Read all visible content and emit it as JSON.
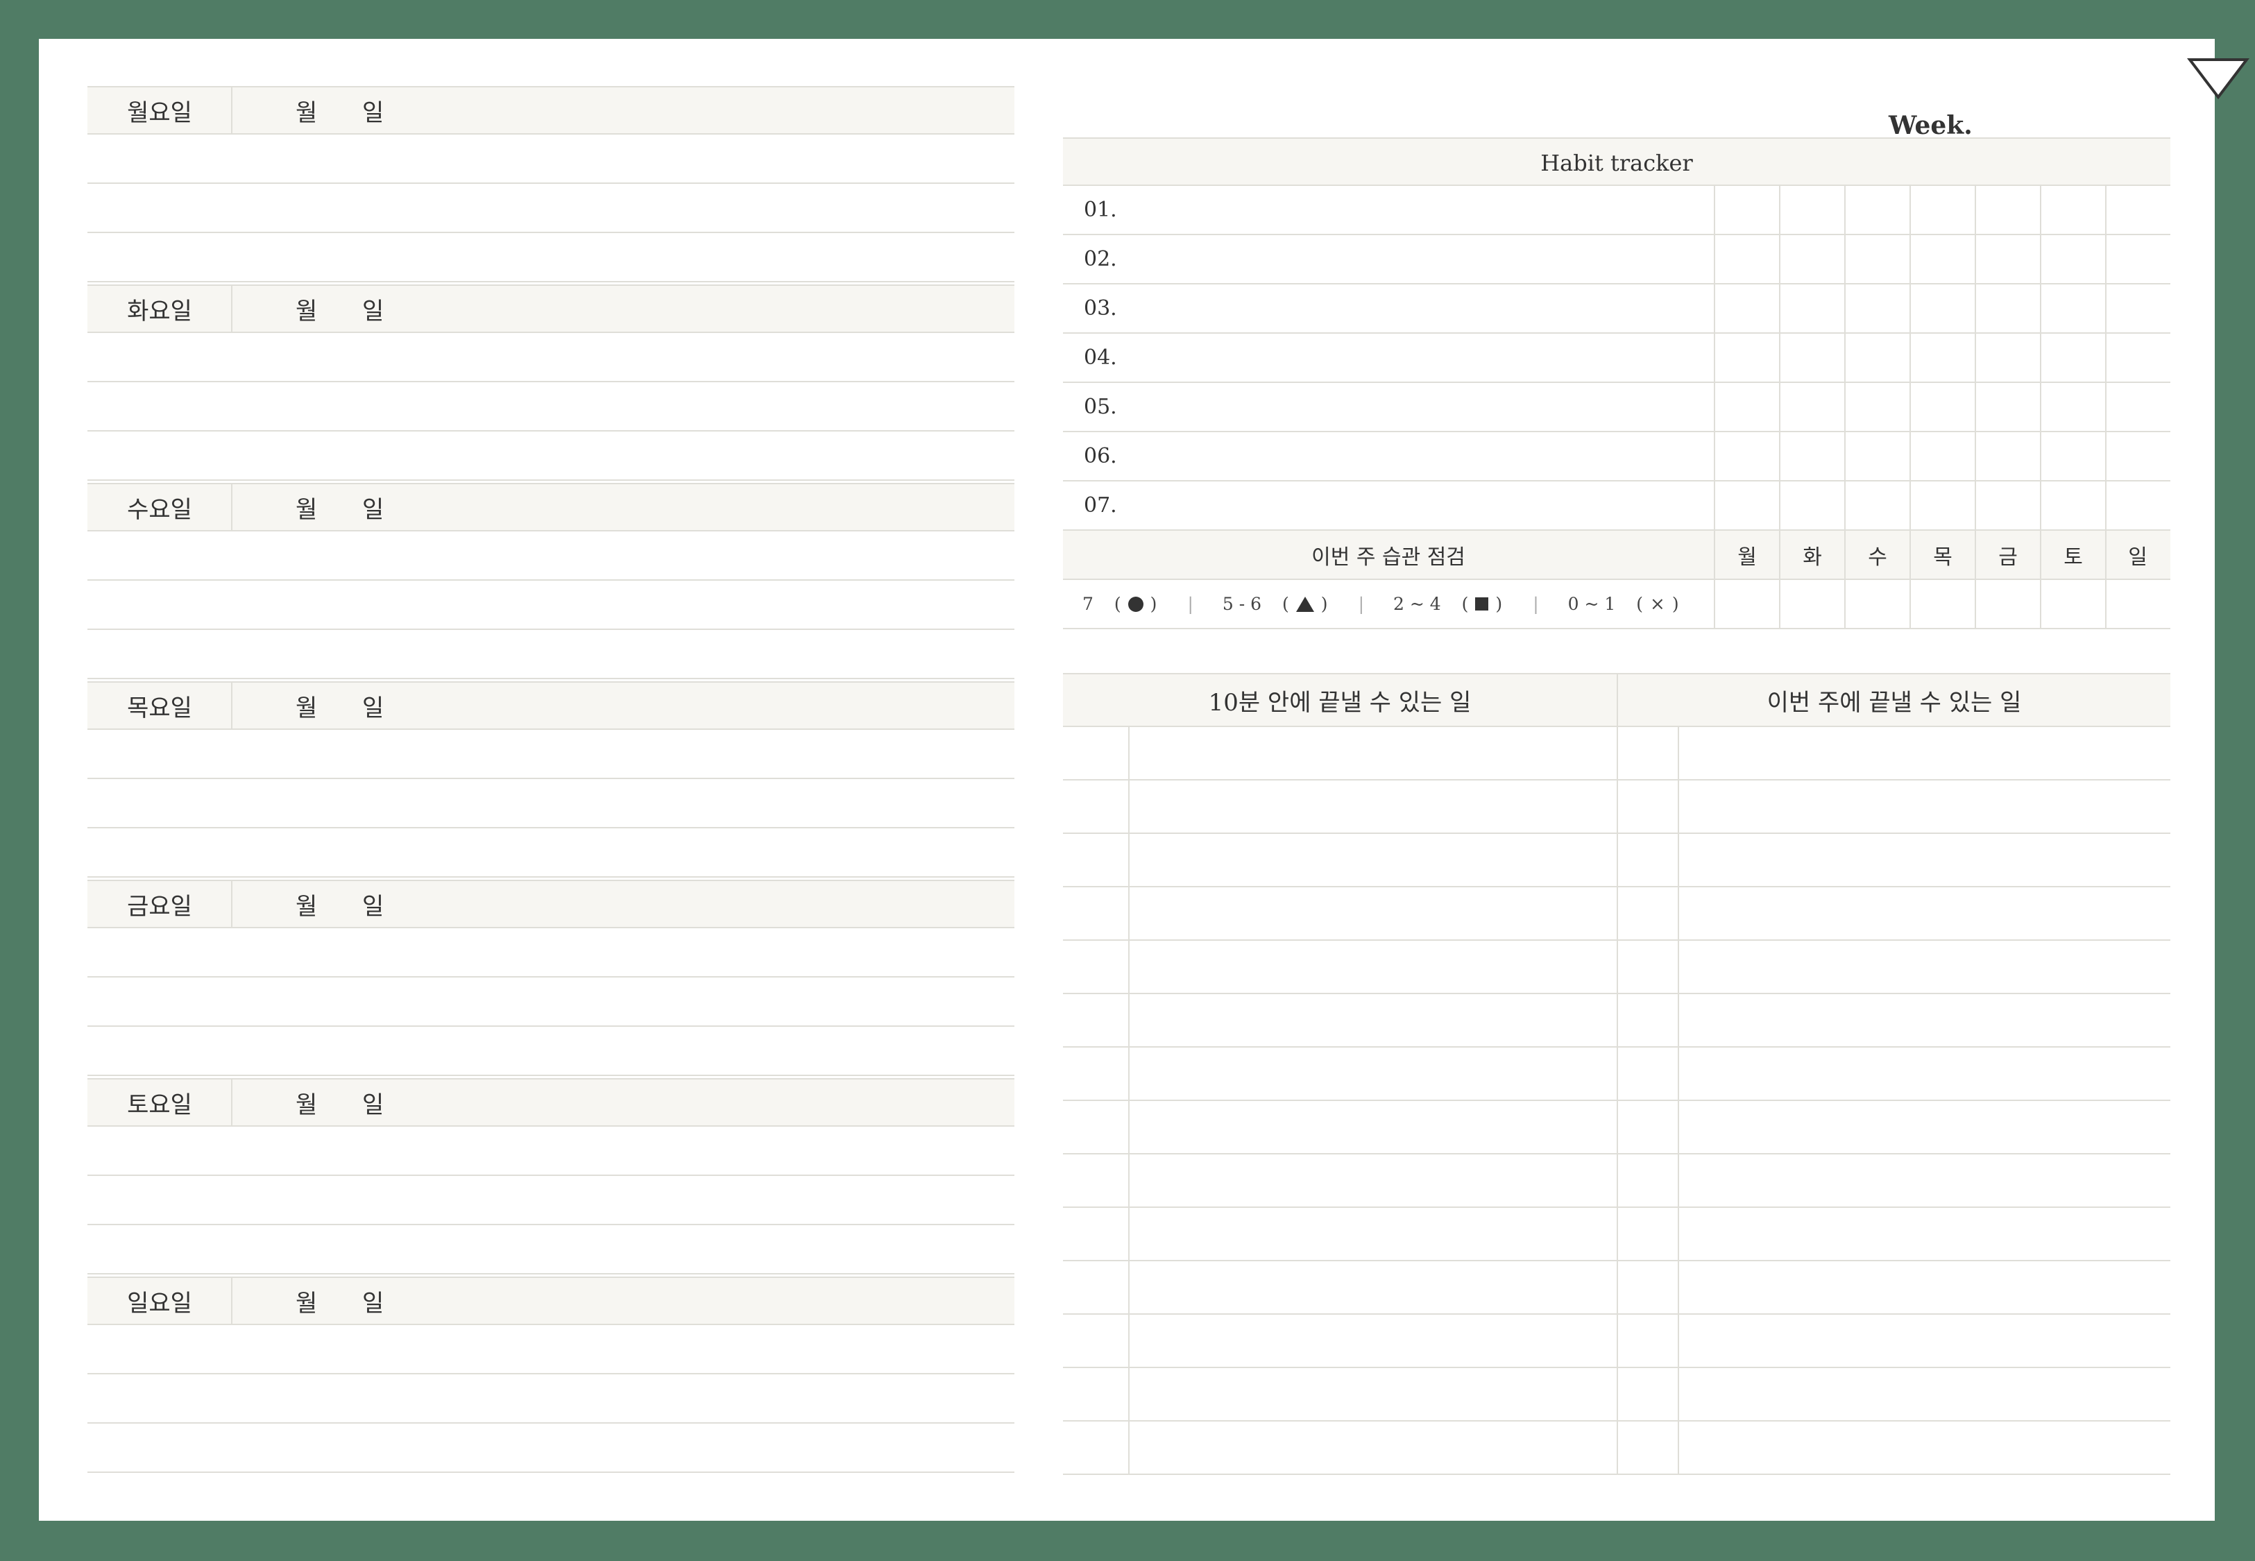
{
  "week": {
    "title": "Week."
  },
  "days": [
    {
      "name": "월요일",
      "month_label": "월",
      "day_label": "일"
    },
    {
      "name": "화요일",
      "month_label": "월",
      "day_label": "일"
    },
    {
      "name": "수요일",
      "month_label": "월",
      "day_label": "일"
    },
    {
      "name": "목요일",
      "month_label": "월",
      "day_label": "일"
    },
    {
      "name": "금요일",
      "month_label": "월",
      "day_label": "일"
    },
    {
      "name": "토요일",
      "month_label": "월",
      "day_label": "일"
    },
    {
      "name": "일요일",
      "month_label": "월",
      "day_label": "일"
    }
  ],
  "habit": {
    "title": "Habit tracker",
    "items": [
      "01.",
      "02.",
      "03.",
      "04.",
      "05.",
      "06.",
      "07."
    ],
    "check_label": "이번 주 습관 점검",
    "weekdays": [
      "월",
      "화",
      "수",
      "목",
      "금",
      "토",
      "일"
    ],
    "legend": [
      {
        "range": "7",
        "open": "(",
        "close": ")",
        "symbol": "circle-filled"
      },
      {
        "range": "5 - 6",
        "open": "(",
        "close": ")",
        "symbol": "triangle-filled"
      },
      {
        "range": "2 ~ 4",
        "open": "(",
        "close": ")",
        "symbol": "square-filled"
      },
      {
        "range": "0 ~ 1",
        "open": "(",
        "close": ")",
        "symbol": "cross",
        "symbol_text": "×"
      }
    ],
    "separator": "|"
  },
  "todo": {
    "left_title": "10분 안에 끝낼 수 있는 일",
    "right_title": "이번 주에 끝낼 수 있는 일"
  },
  "colors": {
    "background": "#507c65",
    "page": "#ffffff",
    "header_fill": "#f7f6f2",
    "line": "#dfded8",
    "text": "#333333"
  }
}
